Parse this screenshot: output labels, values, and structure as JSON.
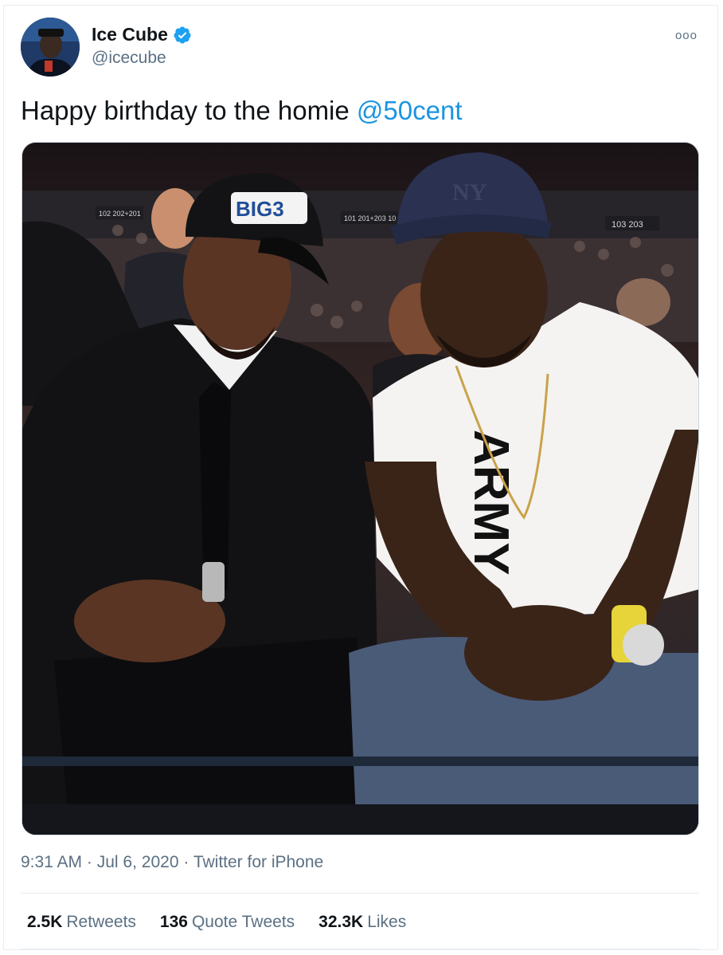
{
  "tweet": {
    "author_name": "Ice Cube",
    "author_handle": "@icecube",
    "text_prefix": "Happy birthday to the homie ",
    "mention": "@50cent",
    "time": "9:31 AM",
    "date": "Jul 6, 2020",
    "source": "Twitter for iPhone",
    "separator": "·",
    "more_icon": "ooo"
  },
  "stats": {
    "retweets_count": "2.5K",
    "retweets_label": "Retweets",
    "quotes_count": "136",
    "quotes_label": "Quote Tweets",
    "likes_count": "32.3K",
    "likes_label": "Likes"
  },
  "photo": {
    "cap_logo": "BIG3",
    "cap_ny": "NY",
    "shirt_text": "ARMY",
    "section_signs": [
      "102 202+201",
      "101 201+203 10",
      "103 203"
    ]
  },
  "colors": {
    "link": "#1b95e0",
    "verified": "#1da1f2",
    "secondary_text": "#5b7083"
  },
  "icons": [
    "verified-badge-icon",
    "more-options-icon"
  ]
}
